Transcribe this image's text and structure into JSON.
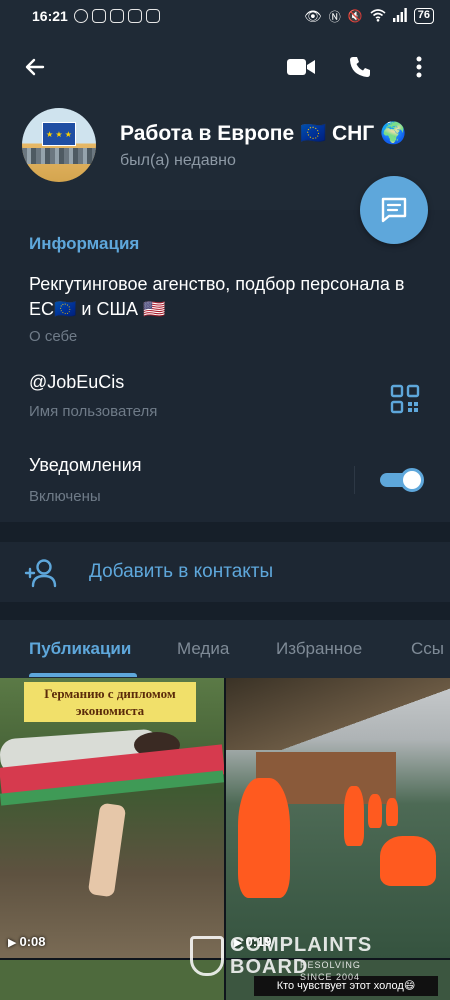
{
  "status_bar": {
    "time": "16:21",
    "battery": "76"
  },
  "header": {
    "title": "Работа в Европе 🇪🇺 СНГ 🌍",
    "last_seen": "был(а) недавно"
  },
  "info": {
    "section_title": "Информация",
    "bio": "Рекгутинговое агенство, подбор персонала в ЕС🇪🇺 и США 🇺🇸",
    "bio_label": "О себе",
    "username": "@JobEuCis",
    "username_label": "Имя пользователя",
    "notifications_title": "Уведомления",
    "notifications_state": "Включены",
    "notifications_enabled": true
  },
  "add_contact_label": "Добавить в контакты",
  "tabs": [
    {
      "label": "Публикации",
      "active": true
    },
    {
      "label": "Медиа",
      "active": false
    },
    {
      "label": "Избранное",
      "active": false
    },
    {
      "label": "Ссы",
      "active": false
    }
  ],
  "media": [
    {
      "caption": "Германию с дипломом экономиста",
      "duration": "0:08"
    },
    {
      "duration": "0:19",
      "subtitle": "Кто чувствует этот холод😄"
    }
  ],
  "watermark": {
    "big_top": "COMPLAINTS",
    "big_bottom": "BOARD",
    "small_top": "RESOLVING",
    "small_bottom": "SINCE 2004"
  },
  "colors": {
    "accent": "#5ea7db",
    "background": "#1d2733",
    "header": "#1f2a36"
  }
}
